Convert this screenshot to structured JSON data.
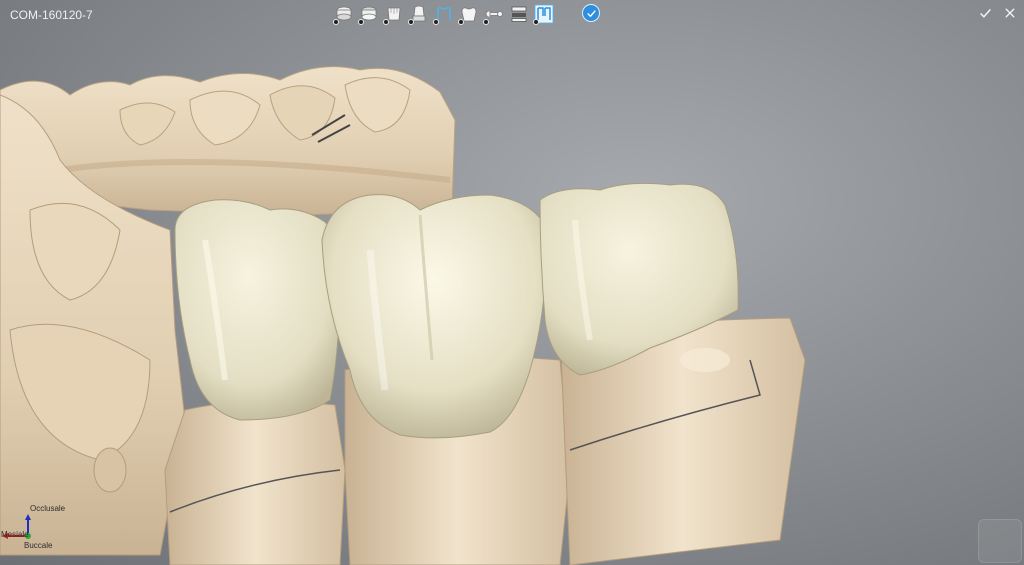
{
  "header": {
    "project_id": "COM-160120-7"
  },
  "toolbar": {
    "tools": [
      {
        "name": "upper-jaw-tool",
        "icon": "jaw-stack-icon"
      },
      {
        "name": "lower-jaw-tool",
        "icon": "jaw-stack-icon"
      },
      {
        "name": "preparation-tool",
        "icon": "tooth-prep-icon"
      },
      {
        "name": "die-tool",
        "icon": "die-icon"
      },
      {
        "name": "crown-outline-tool",
        "icon": "crown-outline-icon"
      },
      {
        "name": "crown-tool",
        "icon": "crown-icon"
      },
      {
        "name": "connector-tool",
        "icon": "bone-connector-icon"
      },
      {
        "name": "layers-tool",
        "icon": "layers-icon"
      },
      {
        "name": "bridge-tool",
        "icon": "bridge-icon"
      }
    ],
    "confirm_icon": "check-circle-icon"
  },
  "window": {
    "accept_icon": "check-icon",
    "close_icon": "close-icon"
  },
  "orientation": {
    "top": "Occlusale",
    "left": "Mesiale",
    "bottom": "Buccale"
  },
  "colors": {
    "accent": "#2f8fde",
    "model": "#e8d7bd",
    "crown": "#e6e2c9"
  }
}
